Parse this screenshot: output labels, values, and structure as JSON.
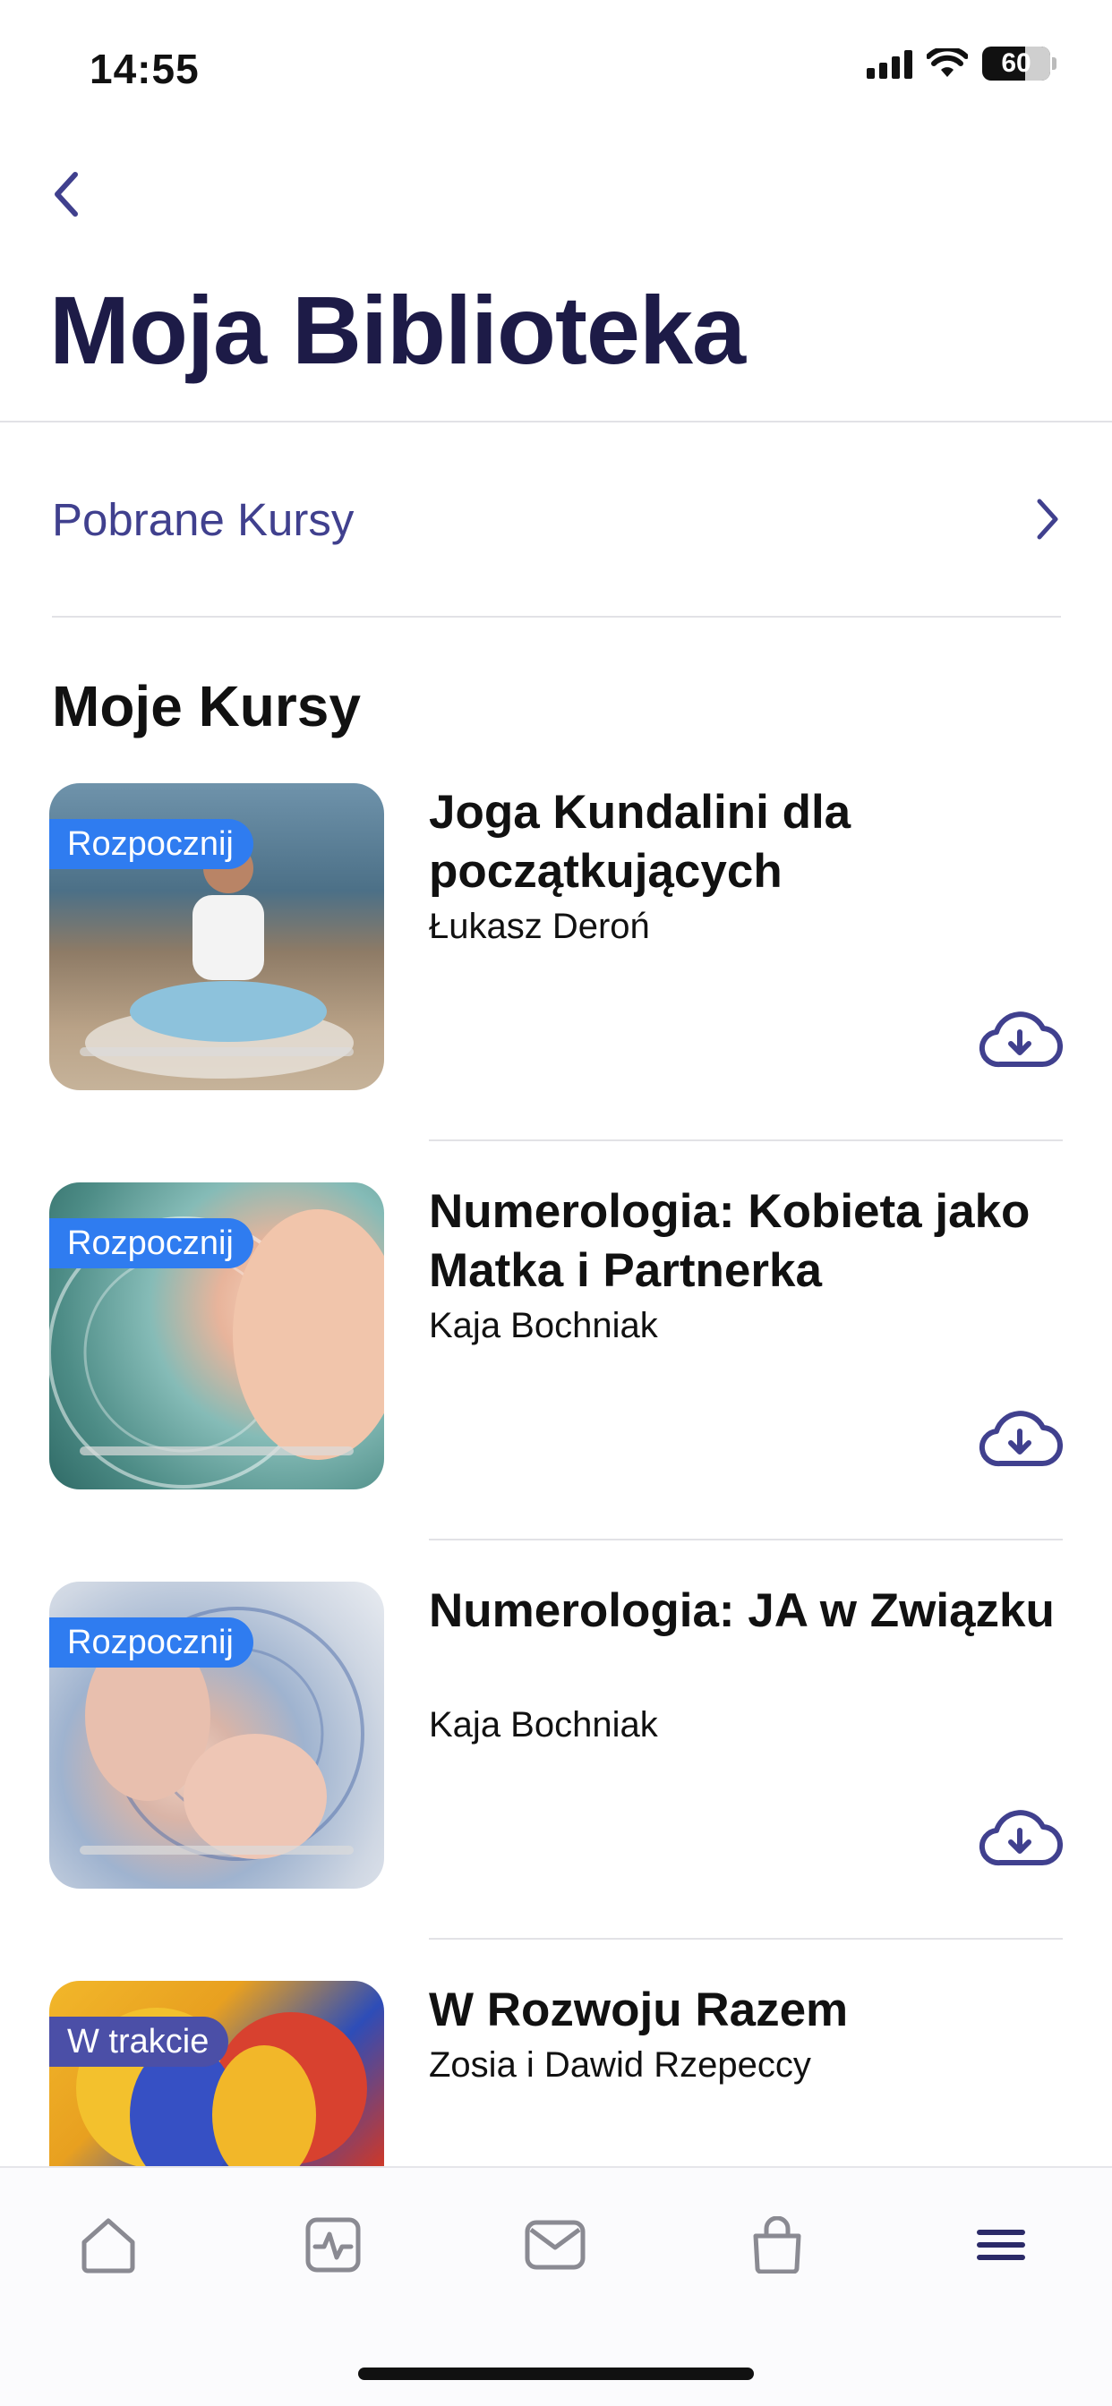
{
  "status_bar": {
    "time": "14:55",
    "battery": "60"
  },
  "header": {
    "back": "back",
    "title": "Moja Biblioteka"
  },
  "downloads": {
    "label": "Pobrane Kursy"
  },
  "section": {
    "title": "Moje Kursy"
  },
  "courses": [
    {
      "title": "Joga Kundalini dla początkujących",
      "author": "Łukasz Deroń",
      "badge": "Rozpocznij",
      "status": "start"
    },
    {
      "title": "Numerologia: Kobieta jako Matka i Partnerka",
      "author": "Kaja Bochniak",
      "badge": "Rozpocznij",
      "status": "start"
    },
    {
      "title": "Numerologia: JA w Związku",
      "author": "Kaja Bochniak",
      "badge": "Rozpocznij",
      "status": "start"
    },
    {
      "title": "W Rozwoju Razem",
      "author": "Zosia i Dawid Rzepeccy",
      "badge": "W trakcie",
      "status": "in-progress"
    }
  ],
  "tab_bar": {
    "items": [
      "home-icon",
      "activity-icon",
      "mail-icon",
      "shop-bag-icon",
      "menu-icon"
    ]
  },
  "colors": {
    "accent": "#40408e",
    "title": "#1d1b47",
    "badge_start": "#2f7cf0",
    "badge_progress": "#4b4fa7"
  }
}
